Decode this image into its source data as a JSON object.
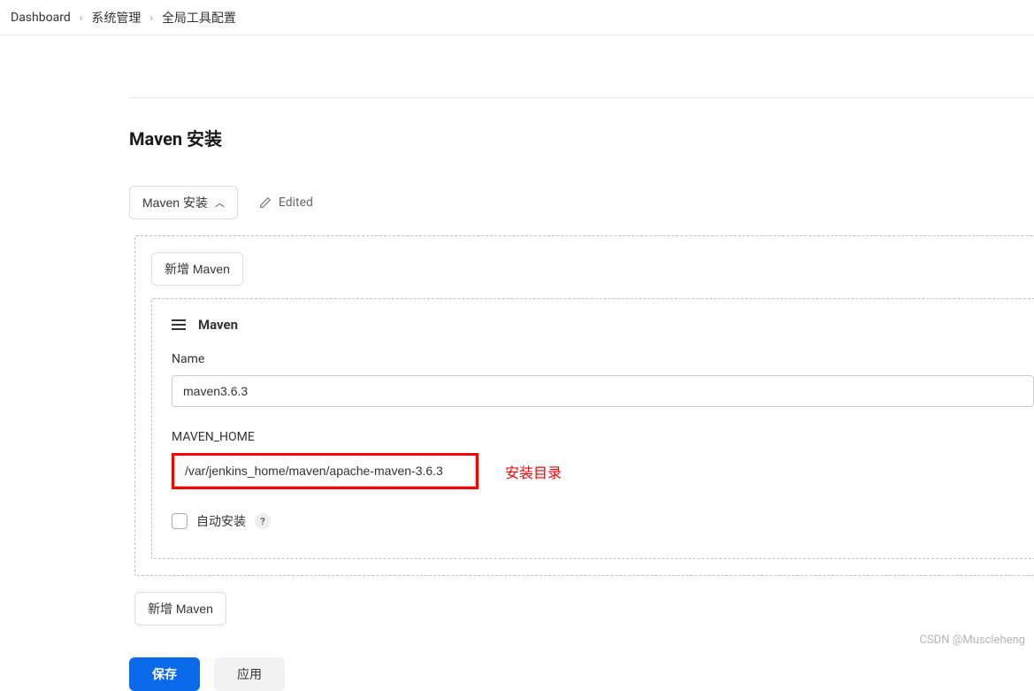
{
  "breadcrumb": {
    "items": [
      "Dashboard",
      "系统管理",
      "全局工具配置"
    ]
  },
  "section": {
    "title": "Maven 安装",
    "toggle_label": "Maven 安装",
    "edited_label": "Edited"
  },
  "buttons": {
    "add_maven_top": "新增 Maven",
    "add_maven_bottom": "新增 Maven",
    "save": "保存",
    "apply": "应用"
  },
  "instance": {
    "header": "Maven",
    "name_label": "Name",
    "name_value": "maven3.6.3",
    "home_label": "MAVEN_HOME",
    "home_value": "/var/jenkins_home/maven/apache-maven-3.6.3",
    "auto_install_label": "自动安装",
    "help_symbol": "?"
  },
  "annotation": {
    "text": "安装目录"
  },
  "watermark": "CSDN @Muscleheng"
}
